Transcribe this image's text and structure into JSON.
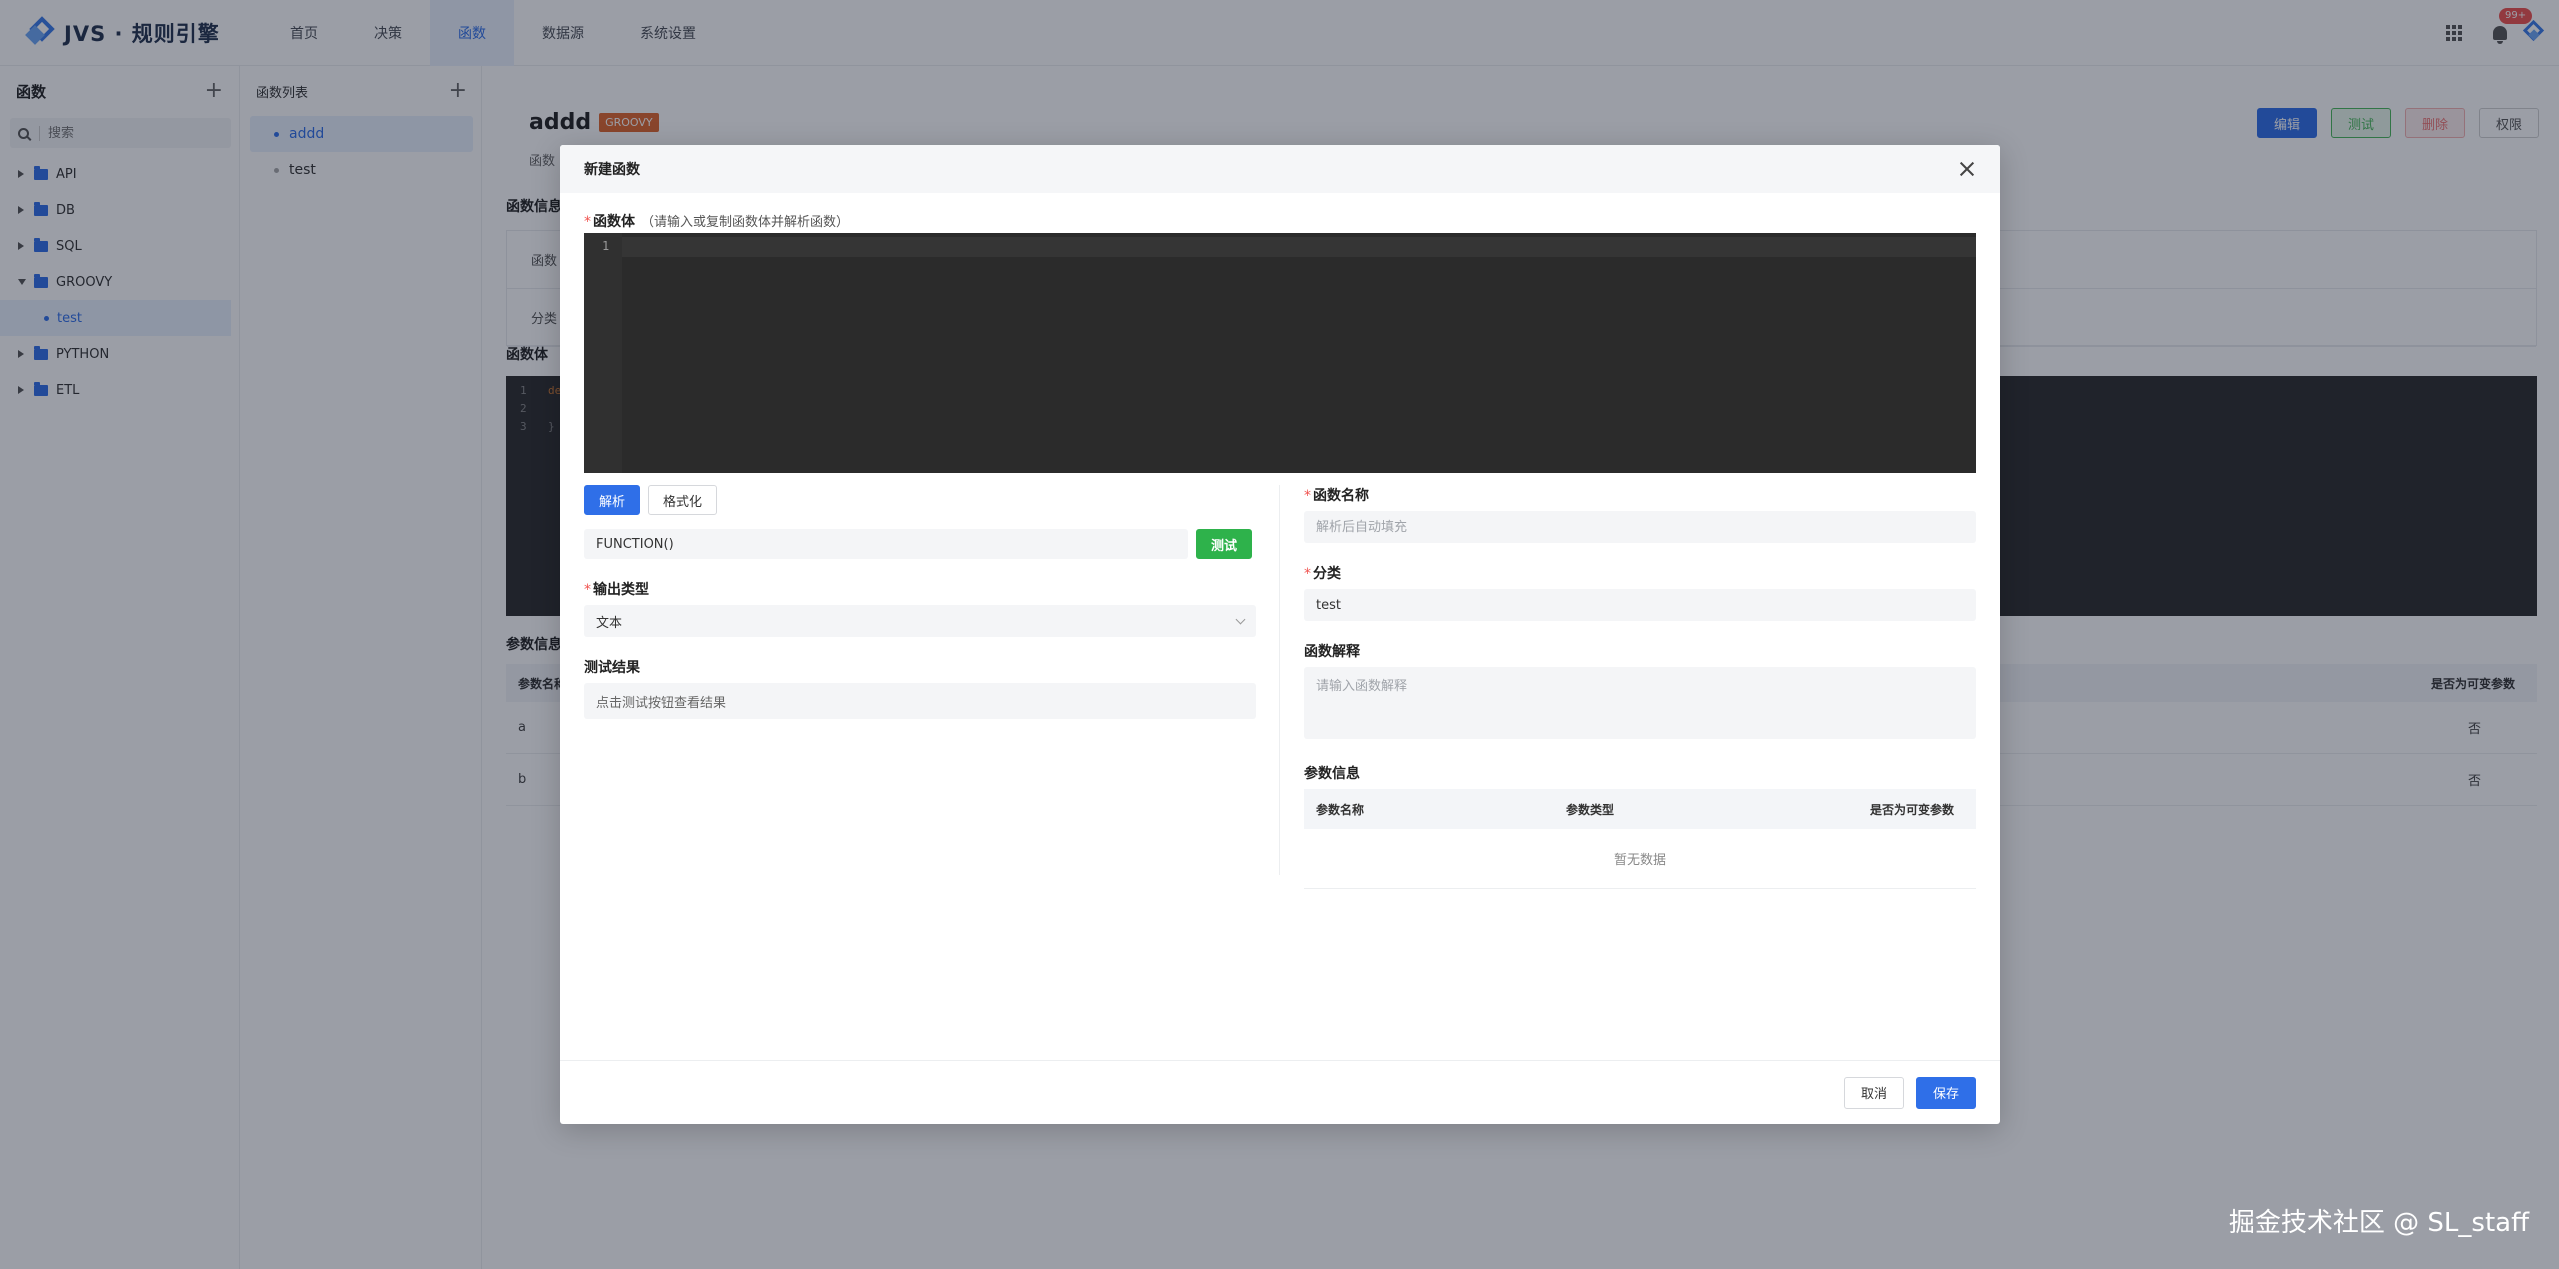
{
  "app": {
    "title": "JVS · 规则引擎"
  },
  "nav": {
    "items": [
      {
        "label": "首页",
        "active": false
      },
      {
        "label": "决策",
        "active": false
      },
      {
        "label": "函数",
        "active": true
      },
      {
        "label": "数据源",
        "active": false
      },
      {
        "label": "系统设置",
        "active": false
      }
    ]
  },
  "header_right": {
    "notification_badge": "99+",
    "icons": [
      "apps-grid-icon",
      "bell-icon",
      "app-logo-icon"
    ]
  },
  "sidebar": {
    "title": "函数",
    "search_placeholder": "搜索",
    "tree": [
      {
        "label": "API",
        "type": "folder",
        "expanded": false
      },
      {
        "label": "DB",
        "type": "folder",
        "expanded": false
      },
      {
        "label": "SQL",
        "type": "folder",
        "expanded": false
      },
      {
        "label": "GROOVY",
        "type": "folder",
        "expanded": true
      },
      {
        "label": "test",
        "type": "leaf",
        "selected": true
      },
      {
        "label": "PYTHON",
        "type": "folder",
        "expanded": false
      },
      {
        "label": "ETL",
        "type": "folder",
        "expanded": false
      }
    ]
  },
  "function_list": {
    "title": "函数列表",
    "items": [
      {
        "label": "addd",
        "active": true
      },
      {
        "label": "test",
        "active": false
      }
    ]
  },
  "main": {
    "title": "addd",
    "tag": "GROOVY",
    "subtitle": "函数",
    "buttons": {
      "edit": "编辑",
      "test": "测试",
      "delete": "删除",
      "permission": "权限"
    },
    "info_section": "函数信息",
    "info_rows": [
      "函数",
      "分类"
    ],
    "body_section": "函数体",
    "code_line_numbers": [
      "1",
      "2",
      "3"
    ],
    "code_fragment": "de",
    "code_close": "}",
    "params_section": "参数信息",
    "params_header": {
      "name": "参数名称",
      "variable": "是否为可变参数"
    },
    "params_rows": [
      {
        "name": "a",
        "variable": "否"
      },
      {
        "name": "b",
        "variable": "否"
      }
    ]
  },
  "modal": {
    "title": "新建函数",
    "body_label": "函数体",
    "body_hint": "（请输入或复制函数体并解析函数）",
    "editor_line": "1",
    "parse_button": "解析",
    "format_button": "格式化",
    "signature_value": "FUNCTION()",
    "test_button": "测试",
    "output_type_label": "输出类型",
    "output_type_value": "文本",
    "test_result_label": "测试结果",
    "test_result_placeholder": "点击测试按钮查看结果",
    "name_label": "函数名称",
    "name_placeholder": "解析后自动填充",
    "category_label": "分类",
    "category_value": "test",
    "desc_label": "函数解释",
    "desc_placeholder": "请输入函数解释",
    "params_label": "参数信息",
    "params_columns": [
      "参数名称",
      "参数类型",
      "是否为可变参数"
    ],
    "params_empty": "暂无数据",
    "cancel_button": "取消",
    "save_button": "保存"
  },
  "watermark": "掘金技术社区 @ SL_staff"
}
